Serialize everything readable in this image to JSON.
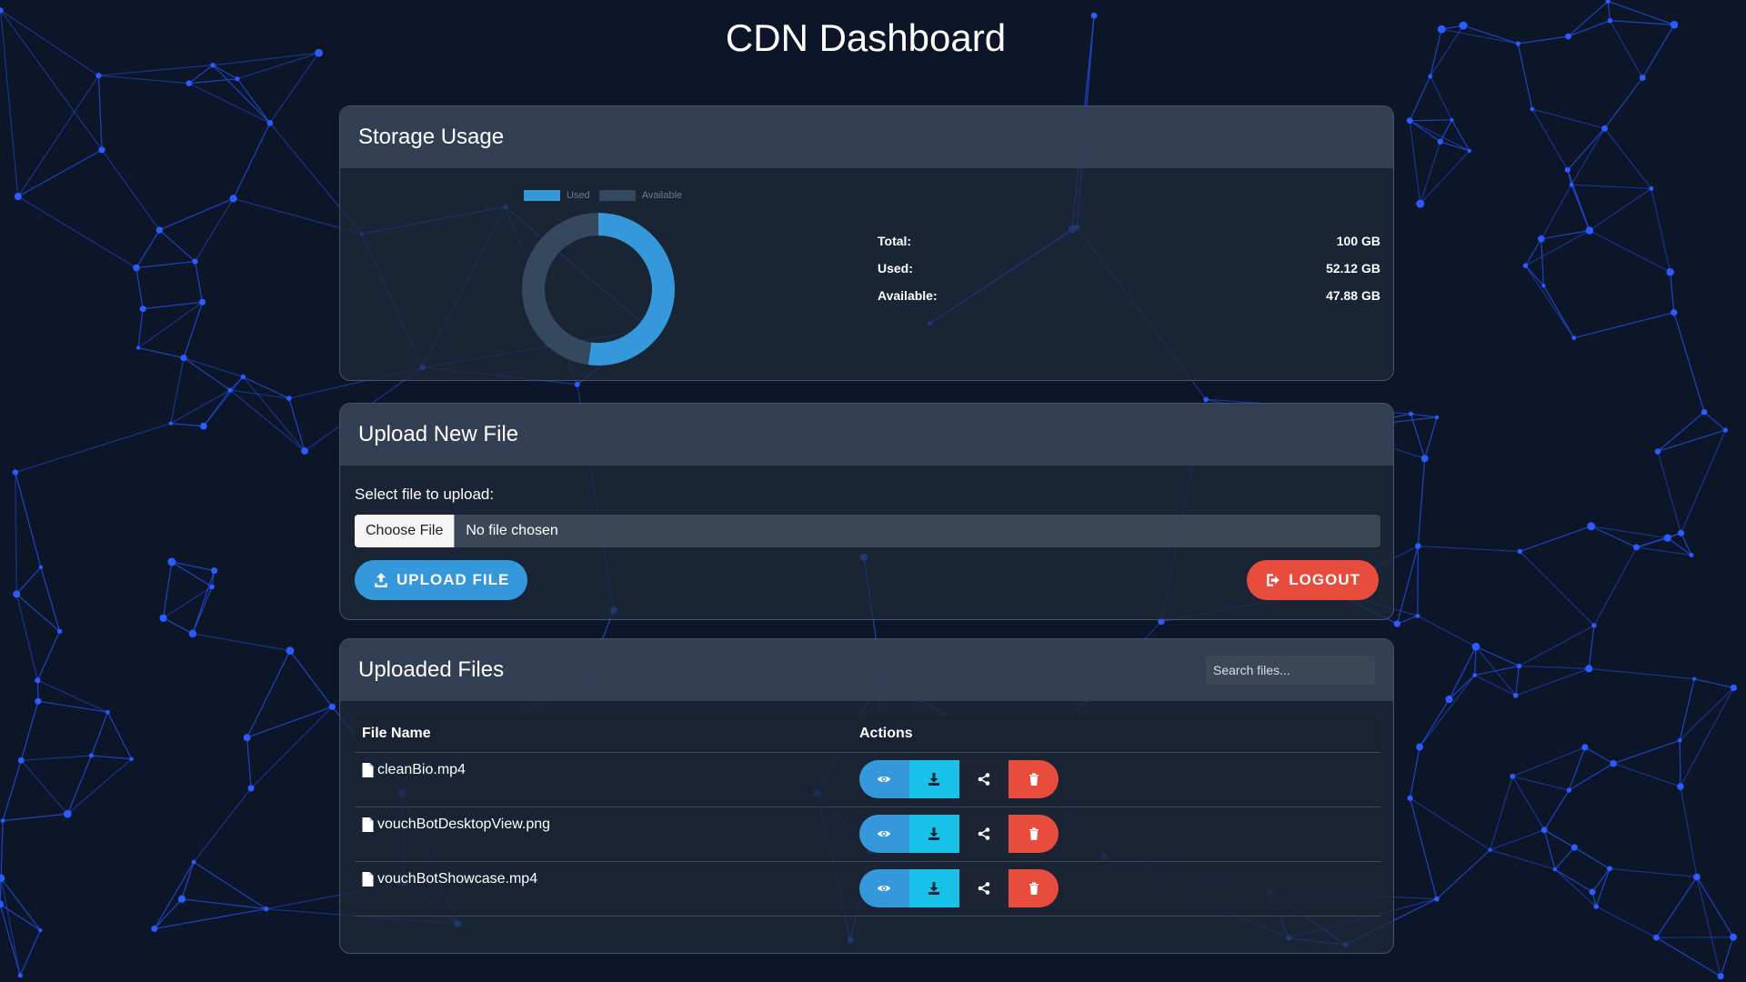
{
  "page": {
    "title": "CDN Dashboard"
  },
  "storage": {
    "title": "Storage Usage",
    "legend": {
      "used": "Used",
      "available": "Available"
    },
    "rows": [
      {
        "label": "Total:",
        "value": "100 GB"
      },
      {
        "label": "Used:",
        "value": "52.12 GB"
      },
      {
        "label": "Available:",
        "value": "47.88 GB"
      }
    ]
  },
  "chart_data": {
    "type": "pie",
    "categories": [
      "Used",
      "Available"
    ],
    "values": [
      52.12,
      47.88
    ],
    "legend_position": "top"
  },
  "upload": {
    "title": "Upload New File",
    "file_label": "Select file to upload:",
    "choose_label": "Choose File",
    "no_file_text": "No file chosen",
    "upload_button": "UPLOAD FILE",
    "logout_button": "LOGOUT"
  },
  "files": {
    "title": "Uploaded Files",
    "search_placeholder": "Search files...",
    "columns": {
      "name": "File Name",
      "actions": "Actions"
    },
    "rows": [
      {
        "name": "cleanBio.mp4"
      },
      {
        "name": "vouchBotDesktopView.png"
      },
      {
        "name": "vouchBotShowcase.mp4"
      }
    ]
  },
  "colors": {
    "used": "#3498db",
    "available": "#34495e",
    "primary": "#3498db",
    "danger": "#e74c3c",
    "info": "#17c1e8",
    "dark": "#1e2433"
  },
  "icons": {
    "upload": "upload-icon",
    "logout": "logout-icon",
    "file": "file-icon",
    "view": "eye-icon",
    "download": "download-icon",
    "share": "share-icon",
    "delete": "trash-icon"
  }
}
